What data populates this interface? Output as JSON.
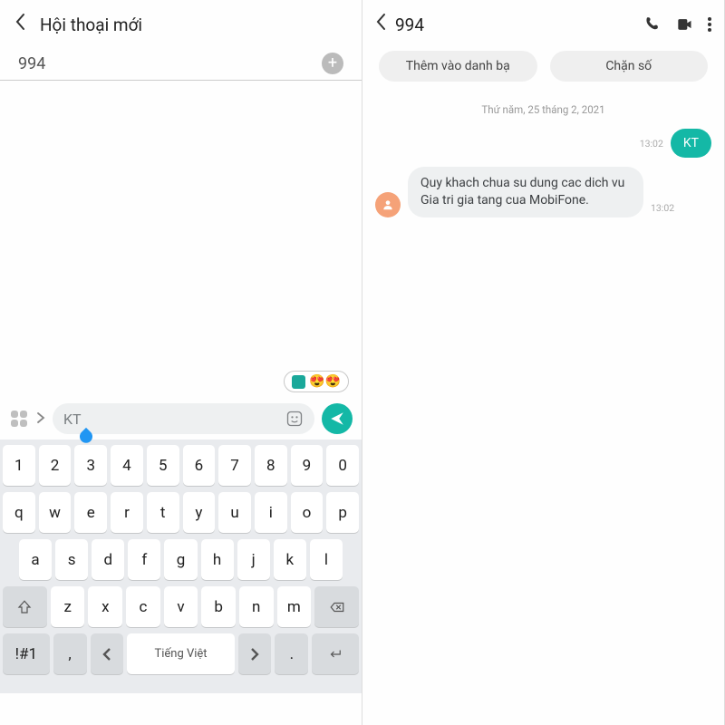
{
  "left": {
    "title": "Hội thoại mới",
    "recipient": "994",
    "compose": "KT",
    "emoji_pill": "😍😍",
    "keyboard": {
      "row1": [
        "1",
        "2",
        "3",
        "4",
        "5",
        "6",
        "7",
        "8",
        "9",
        "0"
      ],
      "row2": [
        "q",
        "w",
        "e",
        "r",
        "t",
        "y",
        "u",
        "i",
        "o",
        "p"
      ],
      "row3": [
        "a",
        "s",
        "d",
        "f",
        "g",
        "h",
        "j",
        "k",
        "l"
      ],
      "row4": [
        "z",
        "x",
        "c",
        "v",
        "b",
        "n",
        "m"
      ],
      "sym": "!#1",
      "comma": ",",
      "space_label": "Tiếng Việt",
      "period": "."
    }
  },
  "right": {
    "title": "994",
    "chip_add": "Thêm vào danh bạ",
    "chip_block": "Chặn số",
    "date": "Thứ năm, 25 tháng 2, 2021",
    "out_time": "13:02",
    "out_text": "KT",
    "in_text": "Quy khach chua su dung cac dich vu Gia tri gia tang cua MobiFone.",
    "in_time": "13:02"
  }
}
